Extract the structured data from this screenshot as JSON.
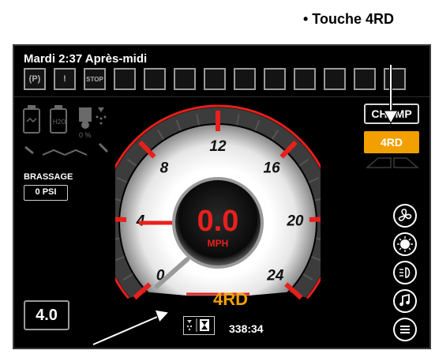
{
  "callouts": {
    "top": "• Touche 4RD"
  },
  "status": {
    "clock": "Mardi 2:37 Après-midi"
  },
  "warning_icons": [
    {
      "name": "parking-brake-icon",
      "label": "(P)"
    },
    {
      "name": "warning-triangle-icon",
      "label": "!"
    },
    {
      "name": "stop-icon",
      "label": "STOP"
    },
    {
      "name": "engine-check-icon",
      "label": ""
    },
    {
      "name": "coolant-temp-icon",
      "label": ""
    },
    {
      "name": "hydraulic-pressure-icon",
      "label": ""
    },
    {
      "name": "hydraulic-filter-icon",
      "label": ""
    },
    {
      "name": "air-filter-icon",
      "label": ""
    },
    {
      "name": "fuel-filter-icon",
      "label": ""
    },
    {
      "name": "transmission-temp-icon",
      "label": ""
    },
    {
      "name": "oil-pressure-icon",
      "label": ""
    },
    {
      "name": "glow-plug-icon",
      "label": ""
    },
    {
      "name": "service-icon",
      "label": ""
    }
  ],
  "left_panel": {
    "h2o_label": "H2O",
    "fan_percent": "0 %",
    "brassage_label": "BRASSAGE",
    "brassage_value": "0 PSI",
    "bottom_value": "4.0"
  },
  "mode": {
    "champ_label": "CHAMP",
    "rd_label": "4RD"
  },
  "gauge": {
    "speed": "0.0",
    "unit": "MPH",
    "ticks": [
      "0",
      "4",
      "8",
      "12",
      "16",
      "20",
      "24"
    ],
    "value": 0,
    "max": 24,
    "mode_label": "4RD"
  },
  "hours": {
    "value": "338:34"
  },
  "colors": {
    "accent": "#f2a000",
    "red": "#e8201c",
    "background": "#000000"
  }
}
